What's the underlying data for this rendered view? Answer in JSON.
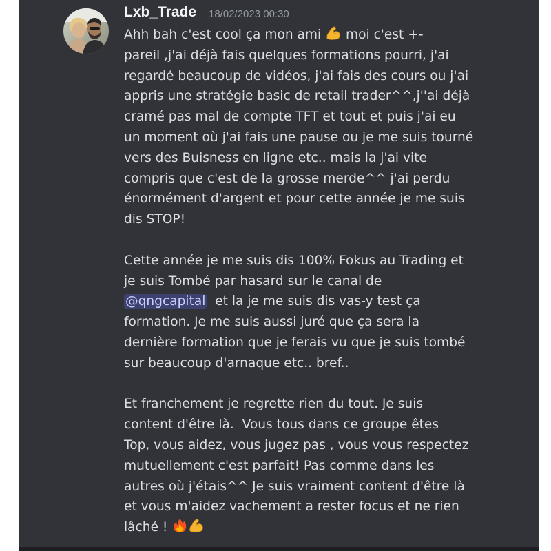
{
  "message": {
    "username": "Lxb_Trade",
    "timestamp": "18/02/2023 00:30",
    "avatar": "user-avatar-photo",
    "lines": {
      "l1a": "Ahh bah c'est cool ça mon ami ",
      "l1b": " moi c'est +-",
      "l2": "pareil ,j'ai déjà fais quelques formations pourri, j'ai",
      "l3": "regardé beaucoup de vidéos, j'ai fais des cours ou j'ai",
      "l4": "appris une stratégie basic de retail trader^^,j''ai déjà",
      "l5": "cramé pas mal de compte TFT et tout et puis j'ai eu",
      "l6": "un moment où j'ai fais une pause ou je me suis tourné",
      "l7": "vers des Buisness en ligne etc.. mais la j'ai vite",
      "l8": "compris que c'est de la grosse merde^^ j'ai perdu",
      "l9": "énormément d'argent et pour cette année je me suis",
      "l10": "dis STOP!",
      "l11": "Cette année je me suis dis 100% Fokus au Trading et",
      "l12": "je suis Tombé par hasard sur le canal de",
      "l13_mention": "@qngcapital",
      "l13b": "  et la je me suis dis vas-y test ça",
      "l14": "formation. Je me suis aussi juré que ça sera la",
      "l15": "dernière formation que je ferais vu que je suis tombé",
      "l16": "sur beaucoup d'arnaque etc.. bref..",
      "l17": "Et franchement je regrette rien du tout. Je suis",
      "l18": "content d'être là.  Vous tous dans ce groupe êtes",
      "l19": "Top, vous aidez, vous jugez pas , vous vous respectez",
      "l20": "mutuellement c'est parfait! Pas comme dans les",
      "l21": "autres où j'étais^^ Je suis vraiment content d'être là",
      "l22": "et vous m'aidez vachement a rester focus et ne rien",
      "l23": "lâché ! "
    },
    "emojis": [
      "flexed-biceps-icon",
      "fire-icon",
      "flexed-biceps-icon"
    ],
    "colors": {
      "background": "#313338",
      "username": "#f2f3f5",
      "timestamp": "#949ba4",
      "text": "#dbdee1",
      "mention_bg": "#4b4f82",
      "mention_text": "#c9cdfb"
    }
  }
}
